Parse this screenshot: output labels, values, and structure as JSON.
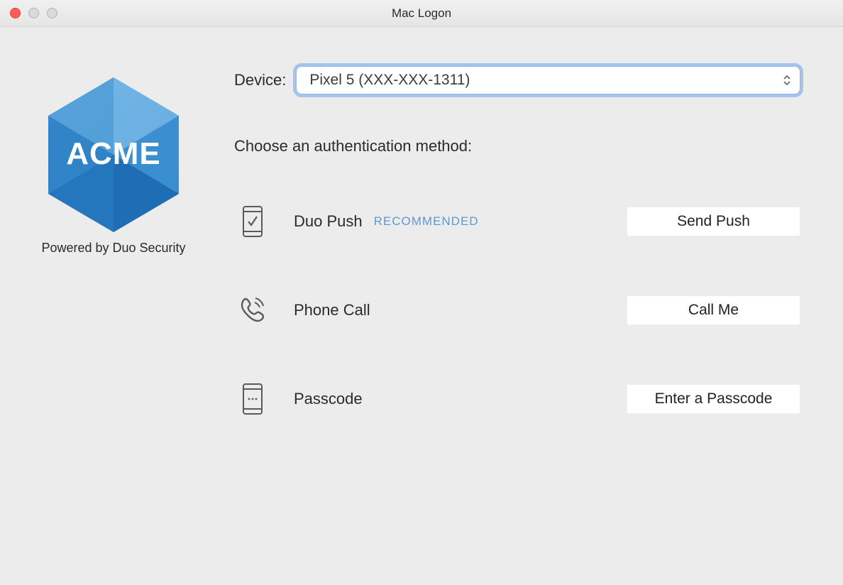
{
  "window": {
    "title": "Mac Logon"
  },
  "brand": {
    "logo_text": "ACME",
    "tagline": "Powered by Duo Security"
  },
  "device": {
    "label": "Device:",
    "selected": "Pixel 5 (XXX-XXX-1311)"
  },
  "instruction": "Choose an authentication method:",
  "methods": {
    "push": {
      "label": "Duo Push",
      "recommended_label": "RECOMMENDED",
      "action": "Send Push"
    },
    "call": {
      "label": "Phone Call",
      "action": "Call Me"
    },
    "passcode": {
      "label": "Passcode",
      "action": "Enter a Passcode"
    }
  }
}
